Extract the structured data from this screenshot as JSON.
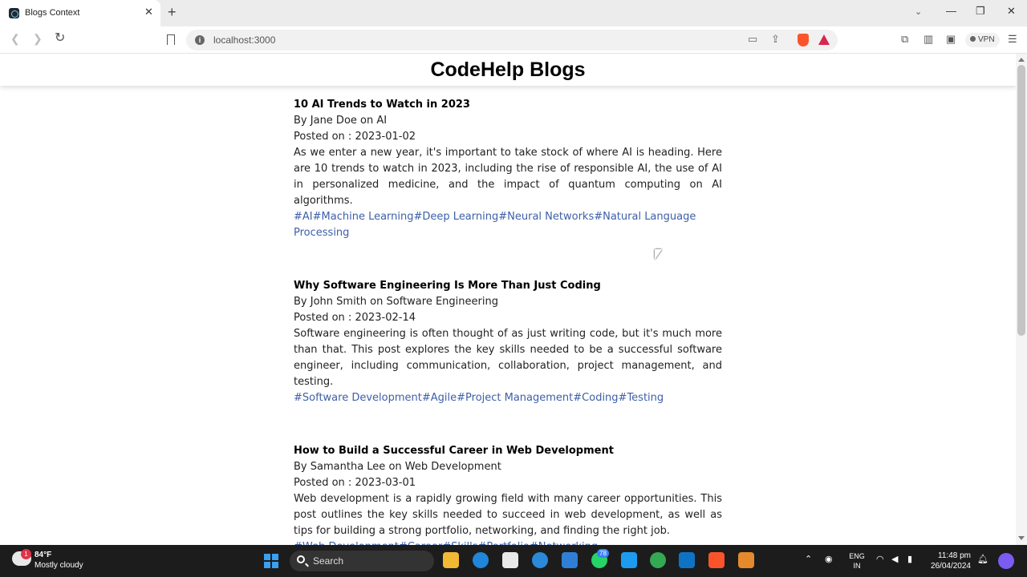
{
  "browser": {
    "tab_title": "Blogs Context",
    "url": "localhost:3000",
    "vpn_label": "VPN"
  },
  "page": {
    "header_title": "CodeHelp Blogs"
  },
  "posts": [
    {
      "title": "10 AI Trends to Watch in 2023",
      "byline_prefix": "By",
      "author": "Jane Doe",
      "on_word": "on",
      "category": "AI",
      "date_prefix": "Posted on :",
      "date": "2023-01-02",
      "content": "As we enter a new year, it's important to take stock of where AI is heading. Here are 10 trends to watch in 2023, including the rise of responsible AI, the use of AI in personalized medicine, and the impact of quantum computing on AI algorithms.",
      "tags": [
        "#AI",
        "#Machine Learning",
        "#Deep Learning",
        "#Neural Networks",
        "#Natural Language Processing"
      ]
    },
    {
      "title": "Why Software Engineering Is More Than Just Coding",
      "byline_prefix": "By",
      "author": "John Smith",
      "on_word": "on",
      "category": "Software Engineering",
      "date_prefix": "Posted on :",
      "date": "2023-02-14",
      "content": "Software engineering is often thought of as just writing code, but it's much more than that. This post explores the key skills needed to be a successful software engineer, including communication, collaboration, project management, and testing.",
      "tags": [
        "#Software Development",
        "#Agile",
        "#Project Management",
        "#Coding",
        "#Testing"
      ]
    },
    {
      "title": "How to Build a Successful Career in Web Development",
      "byline_prefix": "By",
      "author": "Samantha Lee",
      "on_word": "on",
      "category": "Web Development",
      "date_prefix": "Posted on :",
      "date": "2023-03-01",
      "content": "Web development is a rapidly growing field with many career opportunities. This post outlines the key skills needed to succeed in web development, as well as tips for building a strong portfolio, networking, and finding the right job.",
      "tags": [
        "#Web Development",
        "#Career",
        "#Skills",
        "#Portfolio",
        "#Networking"
      ]
    }
  ],
  "taskbar": {
    "weather_badge": "1",
    "weather_temp": "84°F",
    "weather_desc": "Mostly cloudy",
    "search_label": "Search",
    "whatsapp_badge": "78",
    "lang_line1": "ENG",
    "lang_line2": "IN",
    "time": "11:48 pm",
    "date": "26/04/2024"
  },
  "colors": {
    "tag_link": "#3d5fa8",
    "brave_orange": "#fb542b",
    "taskbar_bg": "#1c1c1c"
  }
}
